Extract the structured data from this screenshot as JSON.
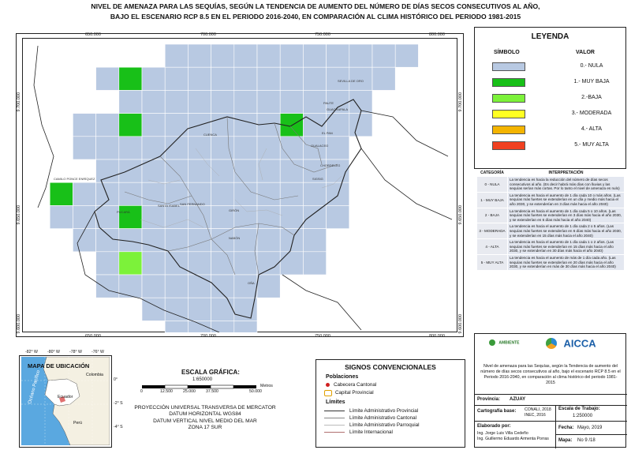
{
  "title": {
    "line1": "NIVEL DE AMENAZA PARA LAS SEQUÍAS, SEGÚN LA TENDENCIA DE AUMENTO DEL NÚMERO DE DÍAS SECOS CONSECUTIVOS AL AÑO,",
    "line2": "BAJO EL ESCENARIO RCP 8.5 EN EL PERIODO 2016-2040, EN COMPARACIÓN AL CLIMA HISTÓRICO DEL PERIODO 1981-2015"
  },
  "map": {
    "x_ticks": [
      "650.000",
      "700.000",
      "750.000",
      "800.000"
    ],
    "y_ticks": [
      "9.700.000",
      "9.650.000",
      "9.600.000"
    ],
    "place_labels": [
      "SEVILLA DE ORO",
      "PAUTE",
      "GUACHAPALA",
      "EL PAN",
      "GUALACEO",
      "CHORDELEG",
      "CUENCA",
      "SIGSIG",
      "NABÓN",
      "OÑA",
      "GIRÓN",
      "SAN FERNANDO",
      "SANTA ISABEL",
      "PUCARÁ",
      "CAMILO PONCE ENRÍQUEZ"
    ]
  },
  "legend": {
    "title": "LEYENDA",
    "col_symbol": "SÍMBOLO",
    "col_value": "VALOR",
    "items": [
      {
        "label": "0.- NULA",
        "color": "#b8c9e2"
      },
      {
        "label": "1.- MUY BAJA",
        "color": "#18c018"
      },
      {
        "label": "2.-BAJA",
        "color": "#7cf23a"
      },
      {
        "label": "3.- MODERADA",
        "color": "#ffff22"
      },
      {
        "label": "4.- ALTA",
        "color": "#f4b400"
      },
      {
        "label": "5.- MUY ALTA",
        "color": "#f04020"
      }
    ]
  },
  "interpretation": {
    "col_category": "CATEGORÍA",
    "col_interp": "INTERPRETACIÓN",
    "rows": [
      {
        "cat": "0 - NULA",
        "text": "La tendencia es hacia la reducción del número de días secos consecutivos al año. (Es decir habrá más días con lluvias y las sequías serían más cortas. Por lo tanto el nivel de amenaza es nulo)"
      },
      {
        "cat": "1 - MUY BAJA",
        "text": "La tendencia es hacia el aumento de 1 día cada 10 o más años. (Las sequías más fuertes se extenderían en un día y medio más hacia el año 2030, y se extenderían en 3 días más hacia el año 2040)"
      },
      {
        "cat": "2 - BAJA",
        "text": "La tendencia es hacia el aumento de 1 día cada 5 o 10 años. (Las sequías más fuertes se extenderían en 3 días más hacia el año 2030, y se extenderían en 6 días más hacia el año 2040)"
      },
      {
        "cat": "3 - MODERADA",
        "text": "La tendencia es hacia el aumento de 1 día cada 2 o 5 años. (Las sequías más fuertes se extenderían en 6 días más hacia el año 2030, y se extenderían en 15 días más hacia el año 2040)"
      },
      {
        "cat": "4 - ALTA",
        "text": "La tendencia es hacia el aumento de 1 día cada 1 o 2 años. (Las sequías más fuertes se extenderían en 15 días más hacia el año 2030, y se extenderían en 30 días más hacia el año 2040)"
      },
      {
        "cat": "5 - MUY ALTA",
        "text": "La tendencia es hacia el aumento de más de 1 día cada año. (Las sequías más fuertes se extenderían en 20 días más hacia el año 2030, y se extenderían en más de 30 días más hacia el año 2040)"
      }
    ]
  },
  "location_map": {
    "title": "MAPA DE UBICACIÓN",
    "labels": {
      "colombia": "Colombia",
      "ecuador": "Ecuador",
      "peru": "Perú",
      "ocean": "Océano Pacífico"
    },
    "lon_ticks": [
      "-82° W",
      "-80° W",
      "-78° W",
      "-76° W"
    ],
    "lat_ticks": [
      "0°",
      "-2° S",
      "-4° S"
    ]
  },
  "scale": {
    "title": "ESCALA GRÁFICA:",
    "ratio": "1:650000",
    "ticks": [
      "0",
      "12.500",
      "25.000",
      "37.500",
      "50.000"
    ],
    "unit": "Metros",
    "projection": [
      "PROYECCIÓN UNIVERSAL TRANSVERSA DE MERCATOR",
      "DATUM HORIZONTAL WGS84",
      "DATUM VERTICAL NIVEL MEDIO DEL MAR",
      "ZONA 17 SUR"
    ]
  },
  "signs": {
    "title": "SIGNOS CONVENCIONALES",
    "pop_heading": "Poblaciones",
    "cabecera": "Cabecera Cantonal",
    "capital": "Capital Provincial",
    "limits_heading": "Límites",
    "limits": [
      {
        "label": "Límite Administrativo Provincial",
        "color": "#333333"
      },
      {
        "label": "Límite Administrativo Cantonal",
        "color": "#888888"
      },
      {
        "label": "Límite Administrativo Parroquial",
        "color": "#bbbbbb"
      },
      {
        "label": "Límite Internacional",
        "color": "#b07070"
      }
    ]
  },
  "info": {
    "logos": [
      "AMBIENTE",
      "AICCA"
    ],
    "description": "Nivel de amenaza para las Sequías, según la Tendencia de aumento del número de días secos consecutivos al año, bajo el escenario RCP 8.5 en el Periodo 2016-2040, en comparación al clima histórico del periodo 1981-2015",
    "province_label": "Provincia:",
    "province": "AZUAY",
    "carto_label": "Cartografía base:",
    "carto_value": "CONALI, 2018 INEC, 2016",
    "scale_label": "Escala de Trabajo:",
    "scale_value": "1:250000",
    "made_label": "Elaborado por:",
    "authors": [
      "Ing. Jorge Luis Villa Cedeño",
      "Ing. Guillermo Eduardo Armenta Porras"
    ],
    "date_label": "Fecha:",
    "date_value": "Mayo, 2019",
    "map_label": "Mapa:",
    "map_value": "No 9 /18"
  }
}
